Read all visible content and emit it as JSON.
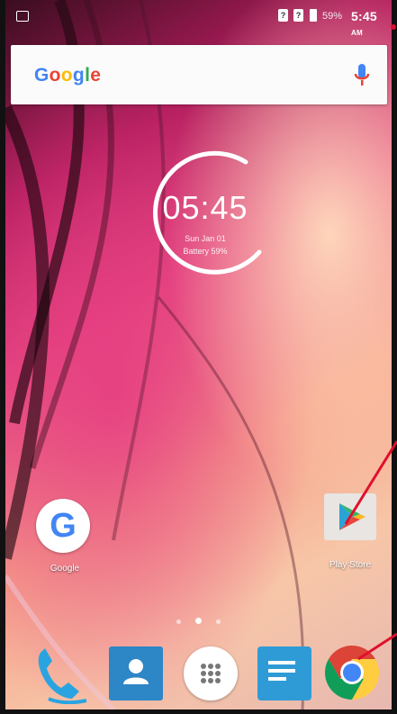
{
  "status_bar": {
    "battery_percent": "59%",
    "time": "5:45",
    "ampm": "AM",
    "sim1_label": "?",
    "sim2_label": "?"
  },
  "search": {
    "logo_text": "Google",
    "logo_colors": [
      "#4285F4",
      "#EA4335",
      "#FBBC05",
      "#4285F4",
      "#34A853",
      "#EA4335"
    ]
  },
  "clock_widget": {
    "time": "05:45",
    "date": "Sun Jan 01",
    "battery": "Battery 59%"
  },
  "apps": {
    "google": {
      "label": "Google"
    },
    "play_store": {
      "label": "Play Store"
    }
  },
  "page_indicator": {
    "pages": 3,
    "active": 1
  },
  "dock": [
    "phone",
    "contacts",
    "app-drawer",
    "messages",
    "chrome"
  ],
  "colors": {
    "annotation_red": "#e0102c",
    "accent_blue": "#4285F4"
  }
}
